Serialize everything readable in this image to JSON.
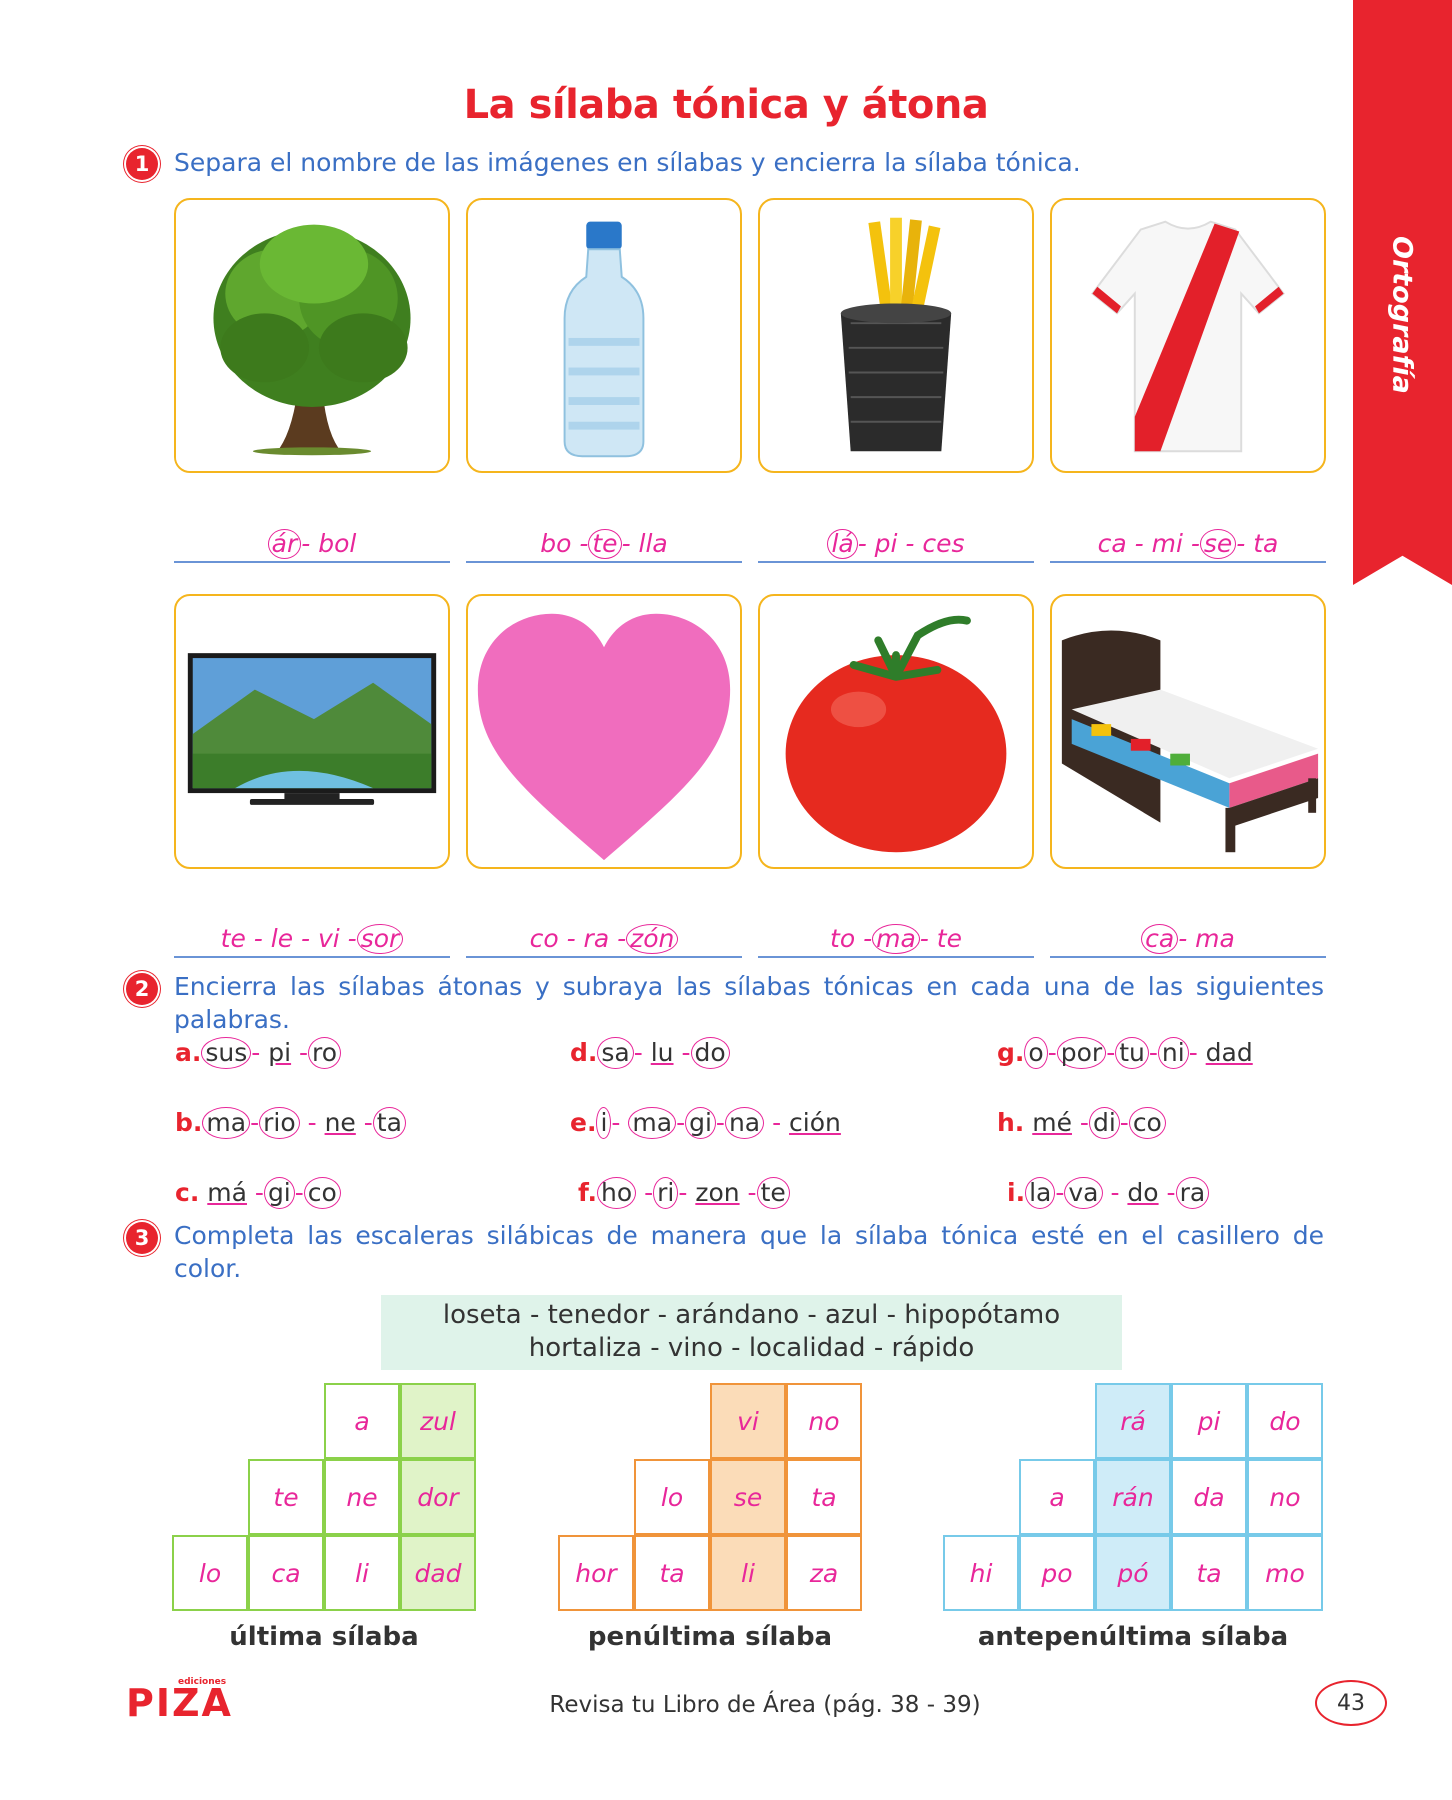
{
  "side_tab": "Ortografía",
  "title": "La sílaba tónica y átona",
  "q1": {
    "num": "1",
    "text": "Separa el nombre de las imágenes en sílabas y encierra la sílaba tónica.",
    "images": [
      "tree",
      "bottle",
      "pencil-cup",
      "jersey",
      "television",
      "heart",
      "tomato",
      "bed"
    ]
  },
  "q2": {
    "num": "2",
    "text": "Encierra las sílabas átonas y subraya las sílabas tónicas en cada una de las siguientes palabras."
  },
  "q3": {
    "num": "3",
    "text": "Completa las escaleras silábicas de manera que la sílaba tónica esté en el casillero de color.",
    "word_box": [
      "loseta - tenedor - arándano - azul - hipopótamo",
      "hortaliza - vino - localidad - rápido"
    ],
    "labels": [
      "última sílaba",
      "penúltima sílaba",
      "antepenúltima sílaba"
    ]
  },
  "footer": {
    "logo_small": "ediciones",
    "logo": "PIZA",
    "text": "Revisa tu Libro de Área (pág. 38 - 39)",
    "page": "43"
  },
  "colors": {
    "red": "#e8242e",
    "blue_text": "#3a6fc4",
    "pink": "#e8279a",
    "card_border": "#f5b51d"
  }
}
